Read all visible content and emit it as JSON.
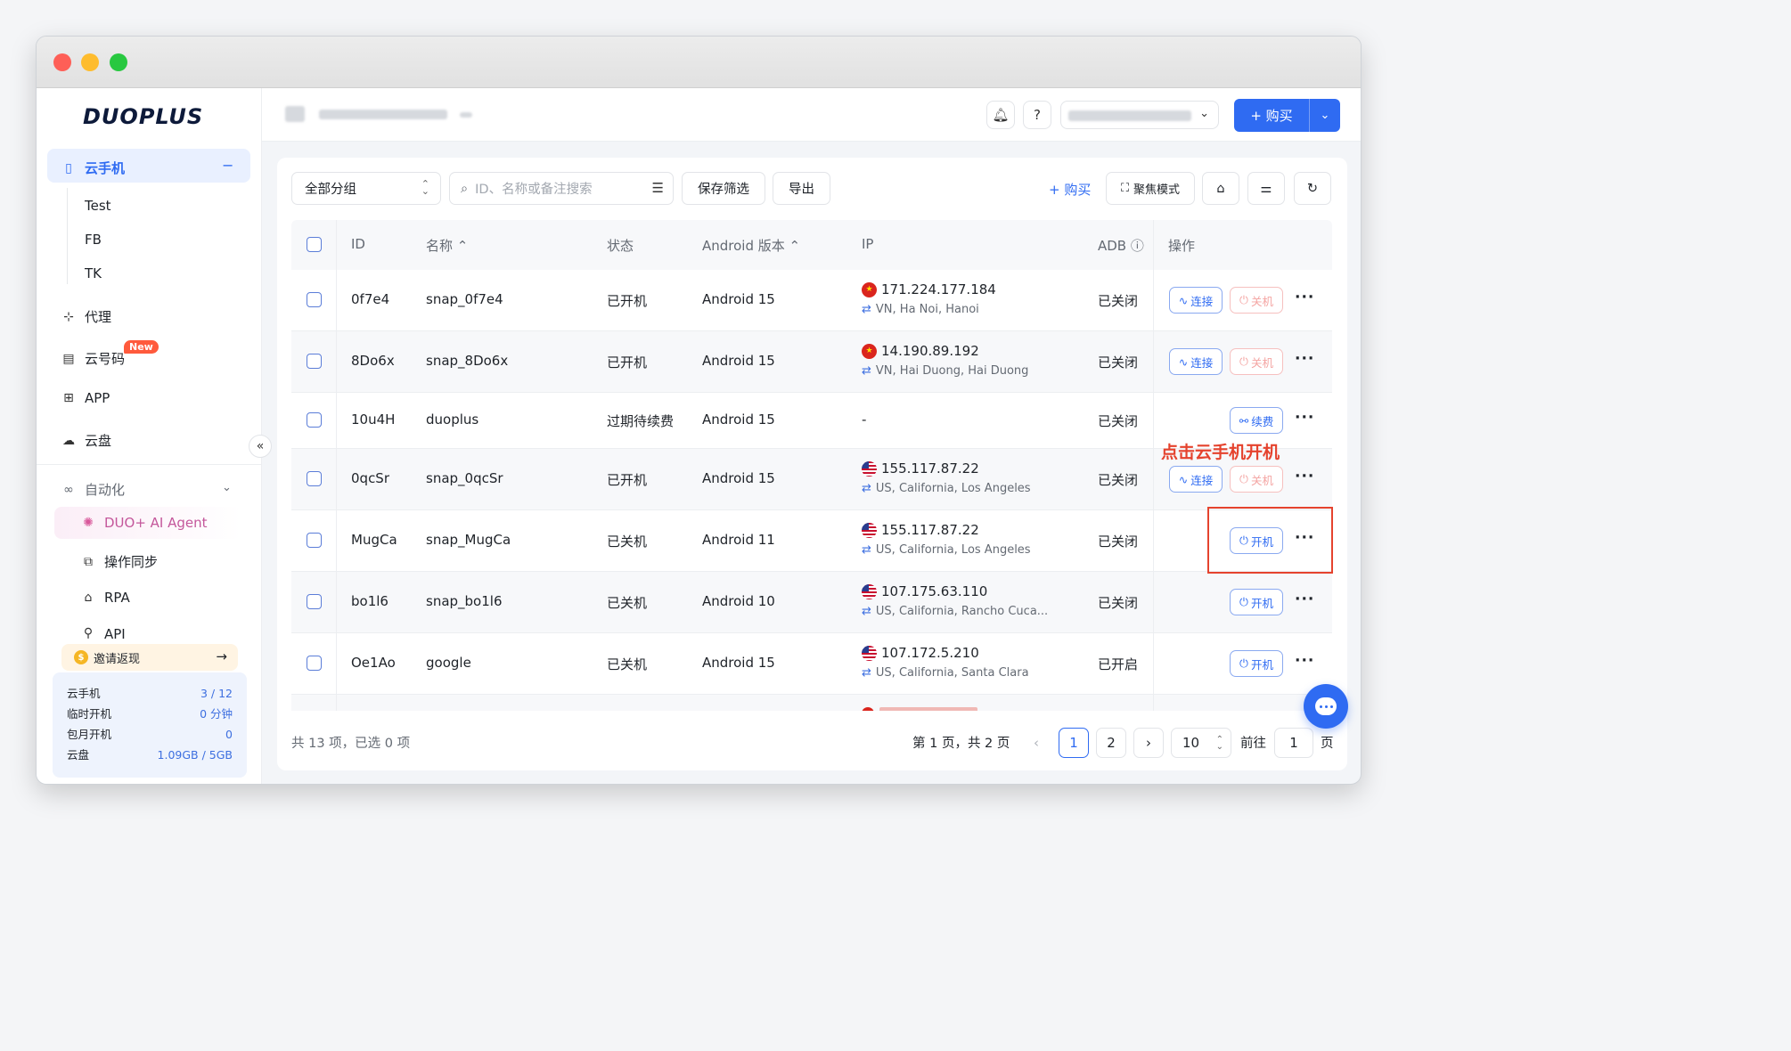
{
  "app": {
    "logo_text": "DUOPLUS"
  },
  "sidebar": {
    "cloud_phone": {
      "label": "云手机",
      "collapse_symbol": "−"
    },
    "groups": [
      {
        "label": "Test"
      },
      {
        "label": "FB"
      },
      {
        "label": "TK"
      }
    ],
    "proxy": {
      "label": "代理"
    },
    "cloud_number": {
      "label": "云号码",
      "badge": "New"
    },
    "app": {
      "label": "APP"
    },
    "cloud_disk": {
      "label": "云盘"
    },
    "automation": {
      "label": "自动化"
    },
    "ai_agent": {
      "label": "DUO+ AI Agent"
    },
    "sync": {
      "label": "操作同步"
    },
    "rpa": {
      "label": "RPA"
    },
    "api": {
      "label": "API"
    },
    "invite": {
      "label": "邀请返现",
      "arrow": "→"
    },
    "stats": [
      {
        "label": "云手机",
        "value": "3 / 12"
      },
      {
        "label": "临时开机",
        "value": "0 分钟"
      },
      {
        "label": "包月开机",
        "value": "0"
      },
      {
        "label": "云盘",
        "value": "1.09GB / 5GB"
      }
    ],
    "collapse_button": "«"
  },
  "header": {
    "buy_label": "+ 购买",
    "account_chevron": "⌄"
  },
  "toolbar": {
    "group_select": "全部分组",
    "search_placeholder": "ID、名称或备注搜索",
    "save_filter": "保存筛选",
    "export": "导出",
    "buy": "+ 购买",
    "focus_mode": "聚焦模式"
  },
  "table": {
    "headers": {
      "id": "ID",
      "name": "名称 ⌃",
      "status": "状态",
      "android": "Android 版本 ⌃",
      "ip": "IP",
      "adb": "ADB ⓘ",
      "actions": "操作"
    },
    "rows": [
      {
        "id": "0f7e4",
        "name": "snap_0f7e4",
        "status": "已开机",
        "android": "Android 15",
        "ip": "171.224.177.184",
        "location": "VN, Ha Noi, Hanoi",
        "flag": "vn",
        "adb": "已关闭",
        "actions": [
          "连接",
          "关机"
        ]
      },
      {
        "id": "8Do6x",
        "name": "snap_8Do6x",
        "status": "已开机",
        "android": "Android 15",
        "ip": "14.190.89.192",
        "location": "VN, Hai Duong, Hai Duong",
        "flag": "vn",
        "adb": "已关闭",
        "actions": [
          "连接",
          "关机"
        ]
      },
      {
        "id": "10u4H",
        "name": "duoplus",
        "status": "过期待续费",
        "android": "Android 15",
        "ip": "-",
        "location": "",
        "flag": "",
        "adb": "已关闭",
        "actions": [
          "续费"
        ]
      },
      {
        "id": "0qcSr",
        "name": "snap_0qcSr",
        "status": "已开机",
        "android": "Android 15",
        "ip": "155.117.87.22",
        "location": "US, California, Los Angeles",
        "flag": "us",
        "adb": "已关闭",
        "actions": [
          "连接",
          "关机"
        ]
      },
      {
        "id": "MugCa",
        "name": "snap_MugCa",
        "status": "已关机",
        "android": "Android 11",
        "ip": "155.117.87.22",
        "location": "US, California, Los Angeles",
        "flag": "us",
        "adb": "已关闭",
        "actions": [
          "开机"
        ]
      },
      {
        "id": "bo1l6",
        "name": "snap_bo1l6",
        "status": "已关机",
        "android": "Android 10",
        "ip": "107.175.63.110",
        "location": "US, California, Rancho Cuca...",
        "flag": "us",
        "adb": "已关闭",
        "actions": [
          "开机"
        ]
      },
      {
        "id": "Oe1Ao",
        "name": "google",
        "status": "已关机",
        "android": "Android 15",
        "ip": "107.172.5.210",
        "location": "US, California, Santa Clara",
        "flag": "us",
        "adb": "已开启",
        "actions": [
          "开机"
        ]
      }
    ],
    "more_symbol": "···"
  },
  "annotation": {
    "text": "点击云手机开机"
  },
  "pagination": {
    "summary_left": "共 13 项，已选 0 项",
    "summary_right": "第 1 页，共 2 页",
    "prev": "‹",
    "next": "›",
    "pages": [
      "1",
      "2"
    ],
    "page_size": "10",
    "goto_label": "前往",
    "goto_value": "1",
    "goto_suffix": "页"
  },
  "colors": {
    "accent": "#2f6bf2",
    "annotation": "#e5432e",
    "danger_light": "#f4a4a2"
  }
}
